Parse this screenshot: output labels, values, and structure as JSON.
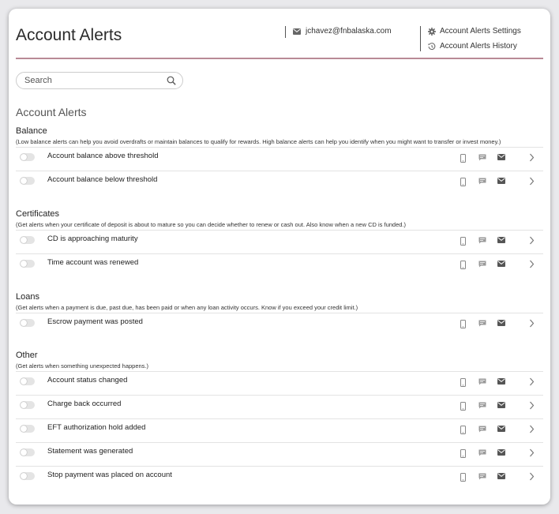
{
  "header": {
    "title": "Account Alerts",
    "email": "jchavez@fnbalaska.com",
    "settings_link": "Account Alerts Settings",
    "history_link": "Account Alerts History"
  },
  "search": {
    "placeholder": "Search"
  },
  "section_title": "Account Alerts",
  "groups": [
    {
      "name": "Balance",
      "description": "(Low balance alerts can help you avoid overdrafts or maintain balances to qualify for rewards. High balance alerts can help you identify when you might want to transfer or invest money.)",
      "items": [
        "Account balance above threshold",
        "Account balance below threshold"
      ]
    },
    {
      "name": "Certificates",
      "description": "(Get alerts when your certificate of deposit is about to mature so you can decide whether to renew or cash out. Also know when a new CD is funded.)",
      "items": [
        "CD is approaching maturity",
        "Time account was renewed"
      ]
    },
    {
      "name": "Loans",
      "description": "(Get alerts when a payment is due, past due, has been paid or when any loan activity occurs. Know if you exceed your credit limit.)",
      "items": [
        "Escrow payment was posted"
      ]
    },
    {
      "name": "Other",
      "description": "(Get alerts when something unexpected happens.)",
      "items": [
        "Account status changed",
        "Charge back occurred",
        "EFT authorization hold added",
        "Statement was generated",
        "Stop payment was placed on account"
      ]
    }
  ],
  "icons": {
    "phone": "mobile-phone-icon",
    "sms": "chat-bubble-icon",
    "mail": "envelope-icon",
    "chevron": "chevron-right-icon"
  },
  "colors": {
    "accent_rule": "#b98a96",
    "toggle_off": "#e4e4e4"
  }
}
